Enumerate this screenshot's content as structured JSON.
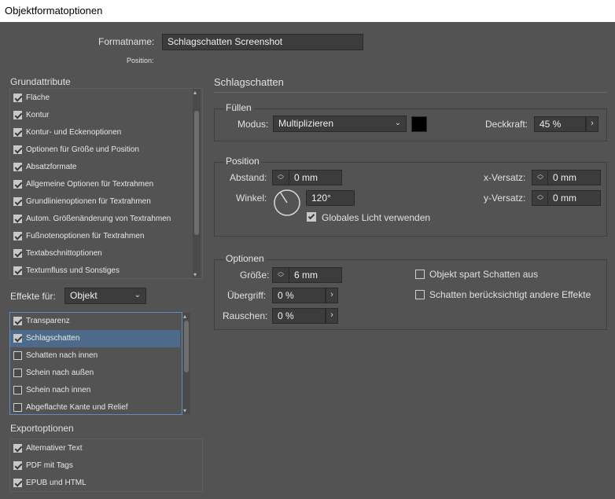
{
  "window": {
    "title": "Objektformatoptionen"
  },
  "header": {
    "formatname_label": "Formatname:",
    "formatname_value": "Schlagschatten Screenshot",
    "position_label": "Position:"
  },
  "grundattribute": {
    "title": "Grundattribute",
    "items": [
      {
        "label": "Fläche",
        "checked": true
      },
      {
        "label": "Kontur",
        "checked": true
      },
      {
        "label": "Kontur- und Eckenoptionen",
        "checked": true
      },
      {
        "label": "Optionen für Größe und Position",
        "checked": true
      },
      {
        "label": "Absatzformate",
        "checked": true
      },
      {
        "label": "Allgemeine Optionen für Textrahmen",
        "checked": true
      },
      {
        "label": "Grundlinienoptionen für Textrahmen",
        "checked": true
      },
      {
        "label": "Autom. Größenänderung von Textrahmen",
        "checked": true
      },
      {
        "label": "Fußnotenoptionen für Textrahmen",
        "checked": true
      },
      {
        "label": "Textabschnittoptionen",
        "checked": true
      },
      {
        "label": "Textumfluss und Sonstiges",
        "checked": true
      }
    ]
  },
  "effekte": {
    "label": "Effekte für:",
    "selected": "Objekt",
    "items": [
      {
        "label": "Transparenz",
        "checked": true,
        "selected": false
      },
      {
        "label": "Schlagschatten",
        "checked": true,
        "selected": true
      },
      {
        "label": "Schatten nach innen",
        "checked": false,
        "selected": false
      },
      {
        "label": "Schein nach außen",
        "checked": false,
        "selected": false
      },
      {
        "label": "Schein nach innen",
        "checked": false,
        "selected": false
      },
      {
        "label": "Abgeflachte Kante und Relief",
        "checked": false,
        "selected": false
      }
    ]
  },
  "export": {
    "title": "Exportoptionen",
    "items": [
      {
        "label": "Alternativer Text",
        "checked": true
      },
      {
        "label": "PDF mit Tags",
        "checked": true
      },
      {
        "label": "EPUB und HTML",
        "checked": true
      }
    ]
  },
  "panel": {
    "title": "Schlagschatten",
    "fuellen": {
      "title": "Füllen",
      "modus_label": "Modus:",
      "modus_value": "Multiplizieren",
      "color": "#000000",
      "deckkraft_label": "Deckkraft:",
      "deckkraft_value": "45 %"
    },
    "position": {
      "title": "Position",
      "abstand_label": "Abstand:",
      "abstand_value": "0 mm",
      "winkel_label": "Winkel:",
      "winkel_value": "120°",
      "global_label": "Globales Licht verwenden",
      "global_checked": true,
      "xversatz_label": "x-Versatz:",
      "xversatz_value": "0 mm",
      "yversatz_label": "y-Versatz:",
      "yversatz_value": "0 mm"
    },
    "optionen": {
      "title": "Optionen",
      "groesse_label": "Größe:",
      "groesse_value": "6 mm",
      "uebergriff_label": "Übergriff:",
      "uebergriff_value": "0 %",
      "rauschen_label": "Rauschen:",
      "rauschen_value": "0 %",
      "spart_label": "Objekt spart Schatten aus",
      "spart_checked": false,
      "beruecks_label": "Schatten berücksichtigt andere Effekte",
      "beruecks_checked": false
    }
  }
}
